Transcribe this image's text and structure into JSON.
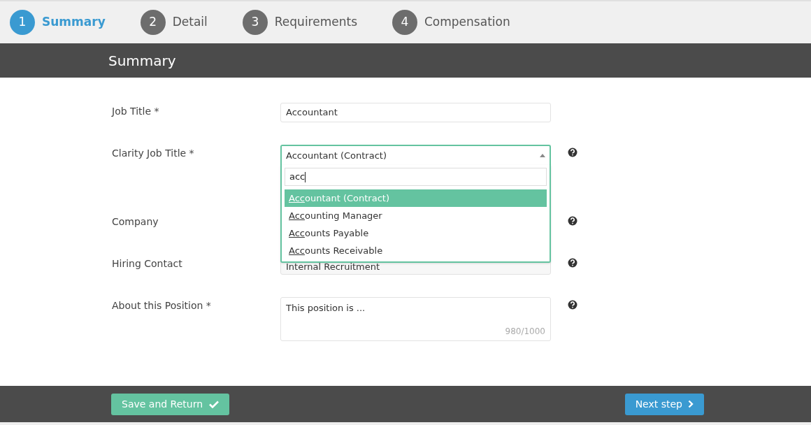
{
  "steps": [
    {
      "number": "1",
      "label": "Summary",
      "selected": true
    },
    {
      "number": "2",
      "label": "Detail",
      "selected": false
    },
    {
      "number": "3",
      "label": "Requirements",
      "selected": false
    },
    {
      "number": "4",
      "label": "Compensation",
      "selected": false
    }
  ],
  "section_title": "Summary",
  "fields": [
    {
      "kind": "text",
      "label": "Job Title *",
      "value": "Accountant",
      "help": false
    },
    {
      "kind": "select",
      "label": "Clarity Job Title *",
      "value": "Accountant (Contract)",
      "help": true,
      "expanded": true,
      "search": "acc",
      "options": [
        {
          "label": "Accountant (Contract)",
          "selected": true
        },
        {
          "label": "Accounting Manager",
          "selected": false
        },
        {
          "label": "Accounts Payable",
          "selected": false
        },
        {
          "label": "Accounts Receivable",
          "selected": false
        }
      ]
    },
    {
      "kind": "hidden",
      "label": "Company",
      "help": true
    },
    {
      "kind": "text",
      "label": "Hiring Contact",
      "value": "Internal Recruitment",
      "help": true
    },
    {
      "kind": "textarea",
      "label": "About this Position *",
      "value": "This position is ...",
      "counter": "980/1000",
      "help": true
    }
  ],
  "footer": {
    "save_button": "Save and Return",
    "next_button": "Next step"
  }
}
